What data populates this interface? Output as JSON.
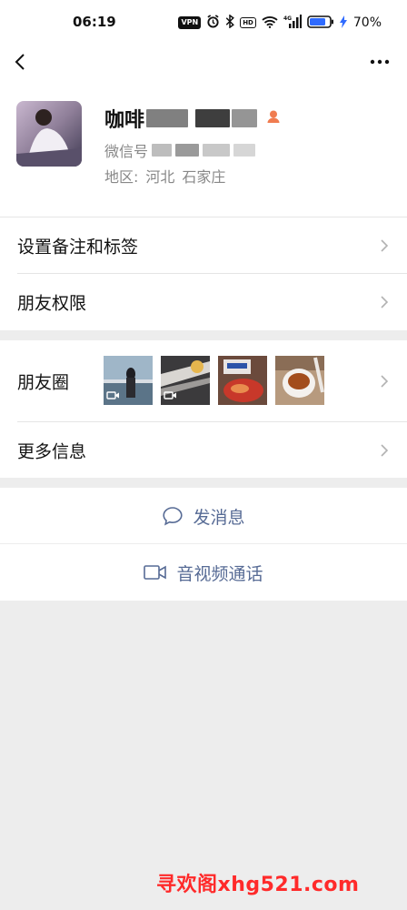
{
  "status_bar": {
    "time": "06:19",
    "vpn": "VPN",
    "hd": "HD",
    "network": "4G",
    "battery": "70%"
  },
  "nav": {
    "back_icon": "chevron-left-icon",
    "more_icon": "more-dots-icon"
  },
  "profile": {
    "nickname": "咖啡",
    "wechat_id_label": "微信号",
    "region_label": "地区:",
    "province": "河北",
    "city": "石家庄",
    "gender_icon": "female-icon"
  },
  "list1": {
    "remarks_label": "设置备注和标签",
    "permissions_label": "朋友权限"
  },
  "list2": {
    "moments_label": "朋友圈",
    "more_info_label": "更多信息"
  },
  "actions": {
    "message_label": "发消息",
    "call_label": "音视频通话"
  },
  "colors": {
    "link_blue": "#576b95",
    "background": "#ededed",
    "gender_orange": "#f07c50"
  },
  "watermark": "寻欢阁xhg521.com"
}
